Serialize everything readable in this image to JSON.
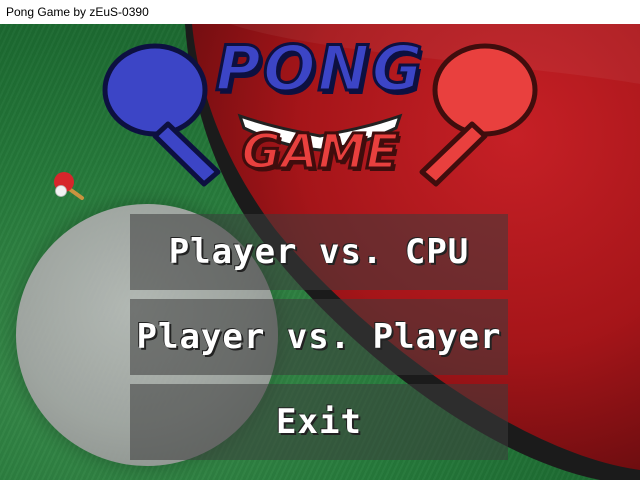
{
  "window": {
    "title": "Pong Game by zEuS-0390"
  },
  "logo": {
    "line1": "PONG",
    "line2": "GAME"
  },
  "menu": {
    "items": [
      {
        "label": "Player vs. CPU"
      },
      {
        "label": "Player vs. Player"
      },
      {
        "label": "Exit"
      }
    ]
  },
  "colors": {
    "table_green": "#267a3b",
    "paddle_red": "#b3181c",
    "logo_blue": "#3c45c6",
    "logo_red": "#e9403e",
    "button_overlay": "rgba(60,60,60,0.55)"
  },
  "icons": [
    "ping-pong-icon",
    "ping-pong-ball-icon",
    "blue-paddle-icon",
    "red-paddle-icon"
  ]
}
